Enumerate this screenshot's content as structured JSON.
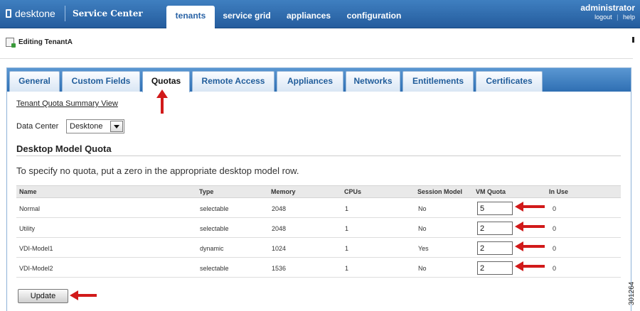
{
  "header": {
    "logo_text": "desktone",
    "app_name": "Service Center",
    "nav": [
      {
        "label": "tenants",
        "active": true
      },
      {
        "label": "service grid",
        "active": false
      },
      {
        "label": "appliances",
        "active": false
      },
      {
        "label": "configuration",
        "active": false
      }
    ],
    "user": {
      "name": "administrator",
      "logout": "logout",
      "separator": "|",
      "help": "help"
    }
  },
  "page": {
    "title": "Editing TenantA",
    "icon": "edit-tenant-icon"
  },
  "tabs": [
    {
      "label": "General",
      "active": false
    },
    {
      "label": "Custom Fields",
      "active": false
    },
    {
      "label": "Quotas",
      "active": true
    },
    {
      "label": "Remote Access",
      "active": false
    },
    {
      "label": "Appliances",
      "active": false
    },
    {
      "label": "Networks",
      "active": false
    },
    {
      "label": "Entitlements",
      "active": false
    },
    {
      "label": "Certificates",
      "active": false
    }
  ],
  "quotas": {
    "summary_link": "Tenant Quota Summary View",
    "data_center_label": "Data Center",
    "data_center_value": "Desktone",
    "section_title": "Desktop Model Quota",
    "hint": "To specify no quota, put a zero in the appropriate desktop model row.",
    "columns": [
      "Name",
      "Type",
      "Memory",
      "CPUs",
      "Session Model",
      "VM Quota",
      "In Use"
    ],
    "rows": [
      {
        "name": "Normal",
        "type": "selectable",
        "memory": "2048",
        "cpus": "1",
        "session_model": "No",
        "vm_quota": "5",
        "in_use": "0"
      },
      {
        "name": "Utility",
        "type": "selectable",
        "memory": "2048",
        "cpus": "1",
        "session_model": "No",
        "vm_quota": "2",
        "in_use": "0"
      },
      {
        "name": "VDI-Model1",
        "type": "dynamic",
        "memory": "1024",
        "cpus": "1",
        "session_model": "Yes",
        "vm_quota": "2",
        "in_use": "0"
      },
      {
        "name": "VDI-Model2",
        "type": "selectable",
        "memory": "1536",
        "cpus": "1",
        "session_model": "No",
        "vm_quota": "2",
        "in_use": "0"
      }
    ],
    "update_label": "Update"
  },
  "figure_code": "301264",
  "colors": {
    "header": "#2f6db0",
    "tab_strip": "#3f80c4",
    "arrow": "#d11a1a"
  }
}
